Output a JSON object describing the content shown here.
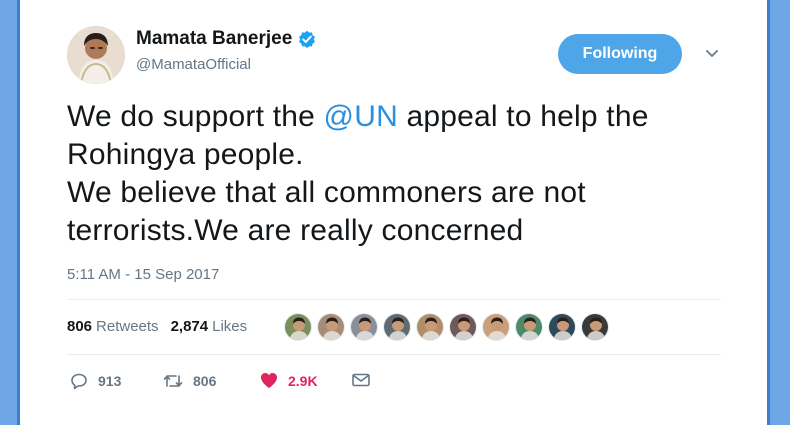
{
  "author": {
    "name": "Mamata Banerjee",
    "handle": "@MamataOfficial",
    "verified": true
  },
  "follow_button": {
    "label": "Following",
    "color": "#4ea6e8"
  },
  "tweet": {
    "line1_prefix": "We do support the ",
    "mention": "@UN",
    "line1_suffix": " appeal  to help the",
    "line2": "Rohingya people.",
    "line3": "We believe that all commoners are not",
    "line4": "terrorists.We are really concerned",
    "mention_color": "#2b8fe0"
  },
  "timestamp": "5:11 AM - 15 Sep 2017",
  "stats": {
    "retweets_count": "806",
    "retweets_label": "Retweets",
    "likes_count": "2,874",
    "likes_label": "Likes"
  },
  "liker_avatars": [
    {
      "name": "liker-avatar-1",
      "color": "#7a8f5c"
    },
    {
      "name": "liker-avatar-2",
      "color": "#a48c7a"
    },
    {
      "name": "liker-avatar-3",
      "color": "#8a8f99"
    },
    {
      "name": "liker-avatar-4",
      "color": "#5f6b73"
    },
    {
      "name": "liker-avatar-5",
      "color": "#b08e6a"
    },
    {
      "name": "liker-avatar-6",
      "color": "#6e5a58"
    },
    {
      "name": "liker-avatar-7",
      "color": "#caa07a"
    },
    {
      "name": "liker-avatar-8",
      "color": "#4e8a6a"
    },
    {
      "name": "liker-avatar-9",
      "color": "#2f4a5a"
    },
    {
      "name": "liker-avatar-10",
      "color": "#3a3a3a"
    }
  ],
  "actions": {
    "replies": "913",
    "retweets": "806",
    "likes": "2.9K",
    "like_color": "#e0245e"
  },
  "icons": {
    "verified": "verified-badge-icon",
    "caret": "chevron-down-icon",
    "reply": "reply-icon",
    "retweet": "retweet-icon",
    "like": "heart-icon",
    "dm": "envelope-icon"
  }
}
